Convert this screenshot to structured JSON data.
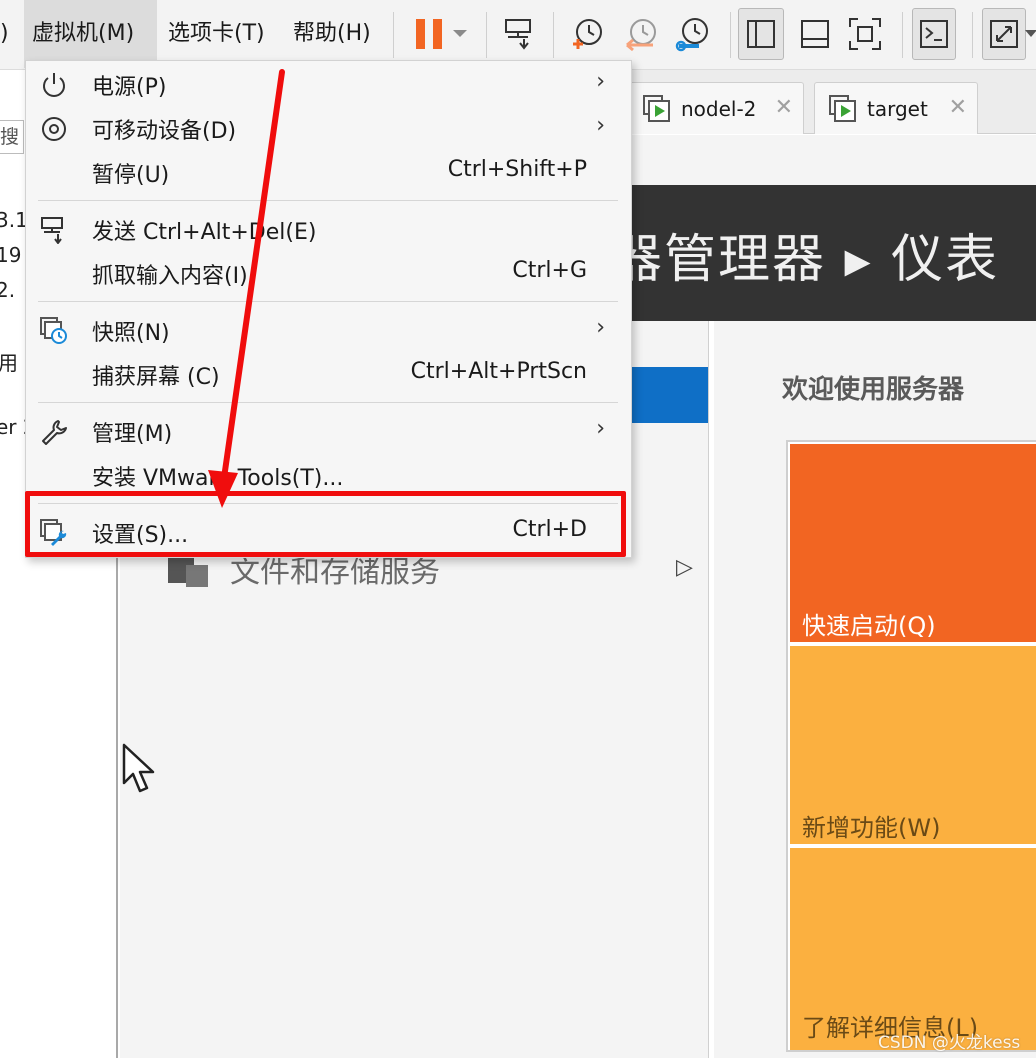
{
  "menubar": {
    "prev_fragment": ")",
    "vm_menu": "虚拟机(M)",
    "tabs_menu": "选项卡(T)",
    "help_menu": "帮助(H)"
  },
  "toolbar": {
    "icons": [
      "pause-icon",
      "dropdown-caret-icon",
      "send-keys-icon",
      "snapshot-take-icon",
      "snapshot-revert-icon",
      "snapshot-manager-icon",
      "view-sidebar-icon",
      "view-console-icon",
      "view-fullscreen-icon",
      "terminal-icon",
      "stretch-icon"
    ],
    "colors": {
      "pause": "#f26522",
      "snapshot_take": "#f26522",
      "snapshot_revert": "#f7a27a",
      "snapshot_manager": "#1b8ad8"
    }
  },
  "left_panel": {
    "search_fragment": "搜",
    "fragments": [
      "3.1",
      "19",
      "2.",
      "用",
      "er 2"
    ]
  },
  "tabs": [
    {
      "label": "nodel-2",
      "icon": "vm-running-icon"
    },
    {
      "label": "target",
      "icon": "vm-running-icon"
    }
  ],
  "dropdown": {
    "items": [
      {
        "label": "电源(P)",
        "shortcut": "",
        "submenu": true,
        "icon": "power-icon"
      },
      {
        "label": "可移动设备(D)",
        "shortcut": "",
        "submenu": true,
        "icon": "removable-device-icon"
      },
      {
        "label": "暂停(U)",
        "shortcut": "Ctrl+Shift+P",
        "submenu": false,
        "icon": ""
      },
      {
        "label": "发送 Ctrl+Alt+Del(E)",
        "shortcut": "",
        "submenu": false,
        "icon": "send-keys-icon"
      },
      {
        "label": "抓取输入内容(I)",
        "shortcut": "Ctrl+G",
        "submenu": false,
        "icon": ""
      },
      {
        "label": "快照(N)",
        "shortcut": "",
        "submenu": true,
        "icon": "snapshot-icon"
      },
      {
        "label": "捕获屏幕 (C)",
        "shortcut": "Ctrl+Alt+PrtScn",
        "submenu": false,
        "icon": ""
      },
      {
        "label": "管理(M)",
        "shortcut": "",
        "submenu": true,
        "icon": "wrench-icon"
      },
      {
        "label": "安装 VMware Tools(T)...",
        "shortcut": "",
        "submenu": false,
        "icon": ""
      },
      {
        "label": "设置(S)...",
        "shortcut": "Ctrl+D",
        "submenu": false,
        "icon": "settings-icon"
      }
    ],
    "submenu_arrow": "›"
  },
  "guest": {
    "header_title": "器管理器 ▸ 仪表",
    "welcome": "欢迎使用服务器",
    "file_storage": "文件和存储服务",
    "file_storage_arrow": "▷",
    "tiles": [
      {
        "label": "快速启动(Q)",
        "color": "#f26522"
      },
      {
        "label": "新增功能(W)",
        "color": "#fbb040"
      },
      {
        "label": "了解详细信息(L)",
        "color": "#fbb040"
      }
    ],
    "header_color": "#333333",
    "selected_color": "#0f6fc6"
  },
  "annotation": {
    "box_color": "#f00d0d",
    "arrow_color": "#f00d0d"
  },
  "watermark": "CSDN @火龙kess"
}
